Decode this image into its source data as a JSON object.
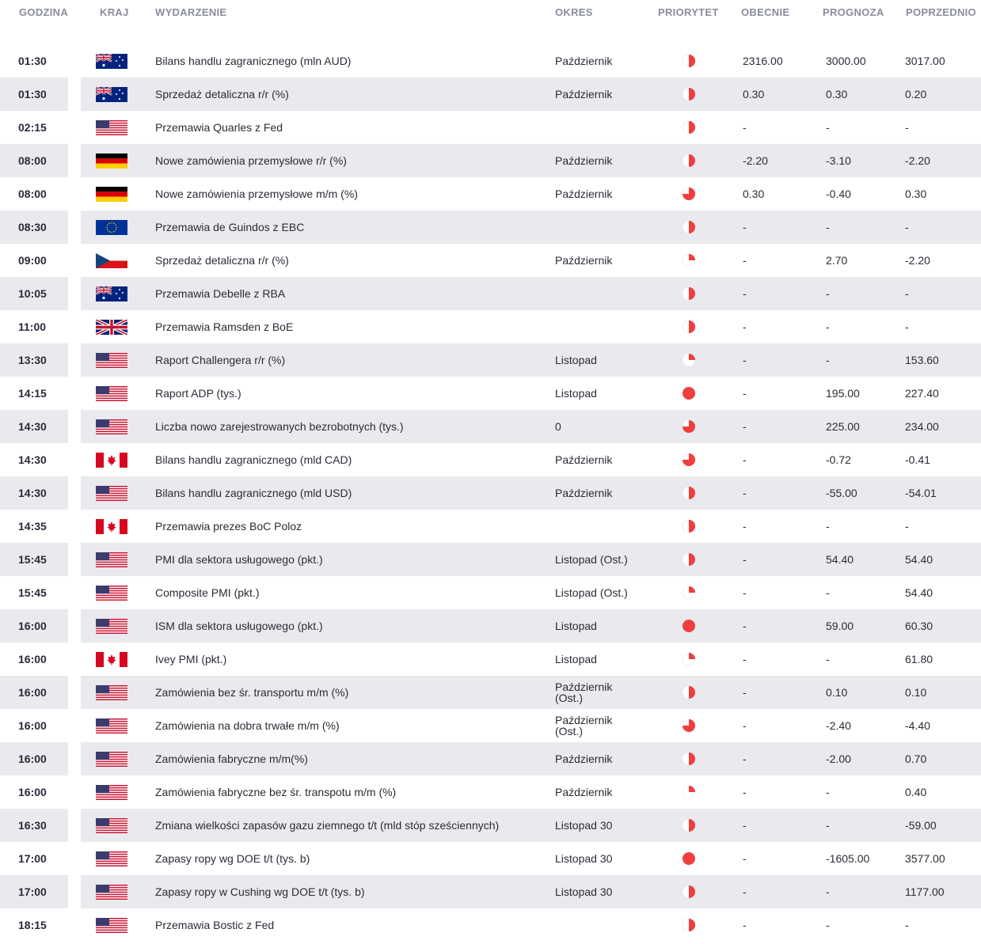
{
  "headers": {
    "time": "GODZINA",
    "country": "KRAJ",
    "event": "WYDARZENIE",
    "period": "OKRES",
    "priority": "PRIORYTET",
    "current": "OBECNIE",
    "forecast": "PROGNOZA",
    "previous": "POPRZEDNIO"
  },
  "colors": {
    "priority": "#f03e3e",
    "row_alt": "#e9e9ee",
    "header_text": "#8a8c9e"
  },
  "rows": [
    {
      "time": "01:30",
      "flag": "au",
      "event": "Bilans handlu zagranicznego (mln AUD)",
      "period": "Październik",
      "priority": 2,
      "current": "2316.00",
      "forecast": "3000.00",
      "previous": "3017.00"
    },
    {
      "time": "01:30",
      "flag": "au",
      "event": "Sprzedaż detaliczna r/r (%)",
      "period": "Październik",
      "priority": 2,
      "current": "0.30",
      "forecast": "0.30",
      "previous": "0.20"
    },
    {
      "time": "02:15",
      "flag": "us",
      "event": "Przemawia Quarles z Fed",
      "period": "",
      "priority": 2,
      "current": "-",
      "forecast": "-",
      "previous": "-"
    },
    {
      "time": "08:00",
      "flag": "de",
      "event": "Nowe zamówienia przemysłowe r/r (%)",
      "period": "Październik",
      "priority": 2,
      "current": "-2.20",
      "forecast": "-3.10",
      "previous": "-2.20"
    },
    {
      "time": "08:00",
      "flag": "de",
      "event": "Nowe zamówienia przemysłowe m/m (%)",
      "period": "Październik",
      "priority": 3,
      "current": "0.30",
      "forecast": "-0.40",
      "previous": "0.30"
    },
    {
      "time": "08:30",
      "flag": "eu",
      "event": "Przemawia de Guindos z EBC",
      "period": "",
      "priority": 2,
      "current": "-",
      "forecast": "-",
      "previous": "-"
    },
    {
      "time": "09:00",
      "flag": "cz",
      "event": "Sprzedaż detaliczna r/r (%)",
      "period": "Październik",
      "priority": 1,
      "current": "-",
      "forecast": "2.70",
      "previous": "-2.20"
    },
    {
      "time": "10:05",
      "flag": "au",
      "event": "Przemawia Debelle z RBA",
      "period": "",
      "priority": 2,
      "current": "-",
      "forecast": "-",
      "previous": "-"
    },
    {
      "time": "11:00",
      "flag": "gb",
      "event": "Przemawia Ramsden z BoE",
      "period": "",
      "priority": 2,
      "current": "-",
      "forecast": "-",
      "previous": "-"
    },
    {
      "time": "13:30",
      "flag": "us",
      "event": "Raport Challengera r/r (%)",
      "period": "Listopad",
      "priority": 1,
      "current": "-",
      "forecast": "-",
      "previous": "153.60"
    },
    {
      "time": "14:15",
      "flag": "us",
      "event": "Raport ADP (tys.)",
      "period": "Listopad",
      "priority": 4,
      "current": "-",
      "forecast": "195.00",
      "previous": "227.40"
    },
    {
      "time": "14:30",
      "flag": "us",
      "event": "Liczba nowo zarejestrowanych bezrobotnych (tys.)",
      "period": "0",
      "priority": 3,
      "current": "-",
      "forecast": "225.00",
      "previous": "234.00"
    },
    {
      "time": "14:30",
      "flag": "ca",
      "event": "Bilans handlu zagranicznego (mld CAD)",
      "period": "Październik",
      "priority": 3,
      "current": "-",
      "forecast": "-0.72",
      "previous": "-0.41"
    },
    {
      "time": "14:30",
      "flag": "us",
      "event": "Bilans handlu zagranicznego (mld USD)",
      "period": "Październik",
      "priority": 2,
      "current": "-",
      "forecast": "-55.00",
      "previous": "-54.01"
    },
    {
      "time": "14:35",
      "flag": "ca",
      "event": "Przemawia prezes BoC Poloz",
      "period": "",
      "priority": 2,
      "current": "-",
      "forecast": "-",
      "previous": "-"
    },
    {
      "time": "15:45",
      "flag": "us",
      "event": "PMI dla sektora usługowego (pkt.)",
      "period": "Listopad (Ost.)",
      "priority": 2,
      "current": "-",
      "forecast": "54.40",
      "previous": "54.40"
    },
    {
      "time": "15:45",
      "flag": "us",
      "event": "Composite PMI (pkt.)",
      "period": "Listopad (Ost.)",
      "priority": 1,
      "current": "-",
      "forecast": "-",
      "previous": "54.40"
    },
    {
      "time": "16:00",
      "flag": "us",
      "event": "ISM dla sektora usługowego (pkt.)",
      "period": "Listopad",
      "priority": 4,
      "current": "-",
      "forecast": "59.00",
      "previous": "60.30"
    },
    {
      "time": "16:00",
      "flag": "ca",
      "event": "Ivey PMI (pkt.)",
      "period": "Listopad",
      "priority": 1,
      "current": "-",
      "forecast": "-",
      "previous": "61.80"
    },
    {
      "time": "16:00",
      "flag": "us",
      "event": "Zamówienia bez śr. transportu m/m (%)",
      "period": "Październik (Ost.)",
      "priority": 2,
      "current": "-",
      "forecast": "0.10",
      "previous": "0.10"
    },
    {
      "time": "16:00",
      "flag": "us",
      "event": "Zamówienia na dobra trwałe m/m (%)",
      "period": "Październik (Ost.)",
      "priority": 3,
      "current": "-",
      "forecast": "-2.40",
      "previous": "-4.40"
    },
    {
      "time": "16:00",
      "flag": "us",
      "event": "Zamówienia fabryczne m/m(%)",
      "period": "Październik",
      "priority": 2,
      "current": "-",
      "forecast": "-2.00",
      "previous": "0.70"
    },
    {
      "time": "16:00",
      "flag": "us",
      "event": "Zamówienia fabryczne bez śr. transpotu m/m (%)",
      "period": "Październik",
      "priority": 1,
      "current": "-",
      "forecast": "-",
      "previous": "0.40"
    },
    {
      "time": "16:30",
      "flag": "us",
      "event": "Zmiana wielkości zapasów gazu ziemnego t/t (mld stóp sześciennych)",
      "period": "Listopad 30",
      "priority": 2,
      "current": "-",
      "forecast": "-",
      "previous": "-59.00"
    },
    {
      "time": "17:00",
      "flag": "us",
      "event": "Zapasy ropy wg DOE t/t (tys. b)",
      "period": "Listopad 30",
      "priority": 4,
      "current": "-",
      "forecast": "-1605.00",
      "previous": "3577.00"
    },
    {
      "time": "17:00",
      "flag": "us",
      "event": "Zapasy ropy w Cushing wg DOE t/t (tys. b)",
      "period": "Listopad 30",
      "priority": 2,
      "current": "-",
      "forecast": "-",
      "previous": "1177.00"
    },
    {
      "time": "18:15",
      "flag": "us",
      "event": "Przemawia Bostic z Fed",
      "period": "",
      "priority": 2,
      "current": "-",
      "forecast": "-",
      "previous": "-"
    }
  ]
}
